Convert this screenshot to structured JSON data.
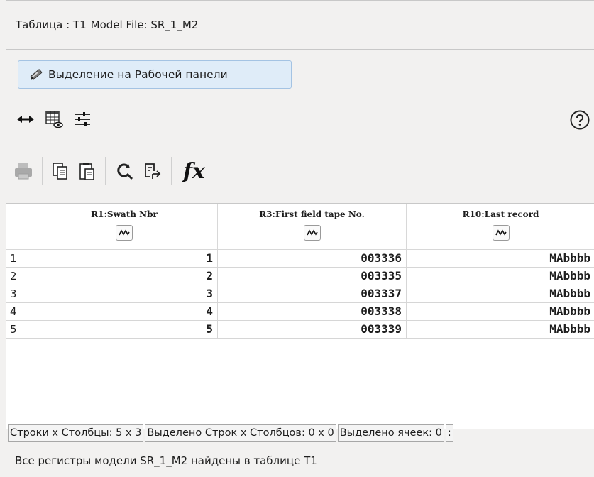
{
  "header": {
    "table_label": "Таблица : T1",
    "model_label": "Model File: SR_1_M2"
  },
  "select_button": {
    "label": "Выделение на Рабочей панели",
    "icon": "pencil-icon"
  },
  "icon_row": [
    "horizontal-arrows-icon",
    "table-view-icon",
    "sliders-icon",
    "help-icon"
  ],
  "toolbar": [
    "print-icon",
    "copy-icon",
    "paste-icon",
    "search-icon",
    "find-replace-icon",
    "fx-icon"
  ],
  "toolbar_fx_label": "fx",
  "table": {
    "columns": [
      "R1:Swath Nbr",
      "R3:First field tape No.",
      "R10:Last record"
    ],
    "rows": [
      {
        "num": "1",
        "cells": [
          "1",
          "003336",
          "MAbbbb"
        ]
      },
      {
        "num": "2",
        "cells": [
          "2",
          "003335",
          "MAbbbb"
        ]
      },
      {
        "num": "3",
        "cells": [
          "3",
          "003337",
          "MAbbbb"
        ]
      },
      {
        "num": "4",
        "cells": [
          "4",
          "003338",
          "MAbbbb"
        ]
      },
      {
        "num": "5",
        "cells": [
          "5",
          "003339",
          "MAbbbb"
        ]
      }
    ]
  },
  "status": {
    "rows_cols": "Строки x Столбцы: 5 x 3",
    "selected_rows_cols": "Выделено Строк x Столбцов: 0 x 0",
    "selected_cells": "Выделено ячеек: 0",
    "extra": ":"
  },
  "message": "Все регистры модели SR_1_M2 найдены в таблице T1"
}
